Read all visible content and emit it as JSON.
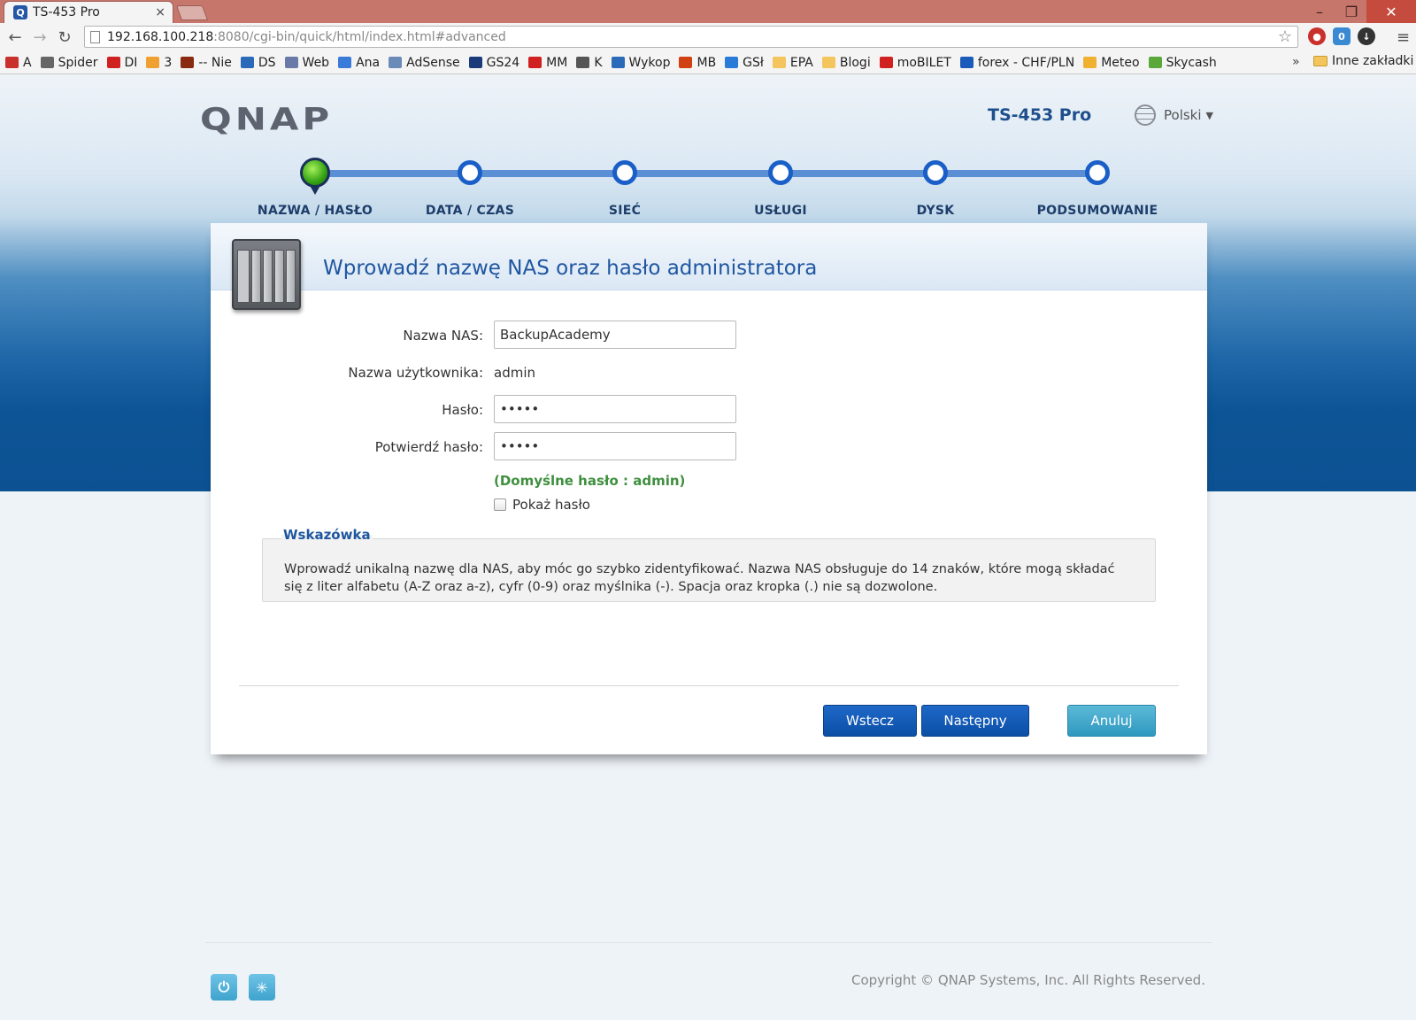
{
  "browser": {
    "tab_title": "TS-453 Pro",
    "tab_favicon": "Q",
    "tab_close": "×",
    "url_main": "192.168.100.218",
    "url_rest": ":8080/cgi-bin/quick/html/index.html#advanced",
    "window_controls": {
      "minimize": "–",
      "maximize": "❐",
      "close": "✕"
    },
    "bookmarks": [
      {
        "label": "A",
        "color": "#c9302c"
      },
      {
        "label": "Spider",
        "color": "#666666"
      },
      {
        "label": "DI",
        "color": "#d02020"
      },
      {
        "label": "3",
        "color": "#f0a030"
      },
      {
        "label": "-- Nie",
        "color": "#8a2a10"
      },
      {
        "label": "DS",
        "color": "#2a6ab8"
      },
      {
        "label": "Web",
        "color": "#6a7aa8"
      },
      {
        "label": "Ana",
        "color": "#3a7ad8"
      },
      {
        "label": "AdSense",
        "color": "#6a8ab8"
      },
      {
        "label": "GS24",
        "color": "#1a3a7a"
      },
      {
        "label": "MM",
        "color": "#d02020"
      },
      {
        "label": "K",
        "color": "#555555"
      },
      {
        "label": "Wykop",
        "color": "#2a6ab8"
      },
      {
        "label": "MB",
        "color": "#d04010"
      },
      {
        "label": "GSł",
        "color": "#2a7ad8"
      },
      {
        "label": "EPA",
        "color": "#f3c55c"
      },
      {
        "label": "Blogi",
        "color": "#f3c55c"
      },
      {
        "label": "moBILET",
        "color": "#d02020"
      },
      {
        "label": "forex - CHF/PLN",
        "color": "#1a5ab8"
      },
      {
        "label": "Meteo",
        "color": "#f0b030"
      },
      {
        "label": "Skycash",
        "color": "#5aa83a"
      }
    ],
    "bookmarks_more": "»",
    "other_bookmarks": "Inne zakładki"
  },
  "header": {
    "logo": "QNAP",
    "model": "TS-453 Pro",
    "language": "Polski"
  },
  "wizard": {
    "steps": [
      "NAZWA / HASŁO",
      "DATA / CZAS",
      "SIEĆ",
      "USŁUGI",
      "DYSK",
      "PODSUMOWANIE"
    ],
    "current_step": 1,
    "total_steps": 6
  },
  "form": {
    "title": "Wprowadź nazwę NAS oraz hasło administratora",
    "nas_name_label": "Nazwa NAS:",
    "nas_name_value": "BackupAcademy",
    "username_label": "Nazwa użytkownika:",
    "username_value": "admin",
    "password_label": "Hasło:",
    "password_value": "•••••",
    "confirm_label": "Potwierdź hasło:",
    "confirm_value": "•••••",
    "default_password_hint": "(Domyślne hasło : admin)",
    "show_password_label": "Pokaż hasło",
    "show_password_checked": false
  },
  "tip": {
    "title": "Wskazówka",
    "text": "Wprowadź unikalną nazwę dla NAS, aby móc go szybko zidentyfikować. Nazwa NAS obsługuje do 14 znaków, które mogą składać się z liter alfabetu (A-Z oraz a-z), cyfr (0-9) oraz myślnika (-). Spacja oraz kropka (.) nie są dozwolone."
  },
  "buttons": {
    "back": "Wstecz",
    "next": "Następny",
    "cancel": "Anuluj"
  },
  "footer": {
    "copyright": "Copyright © QNAP Systems, Inc. All Rights Reserved."
  }
}
